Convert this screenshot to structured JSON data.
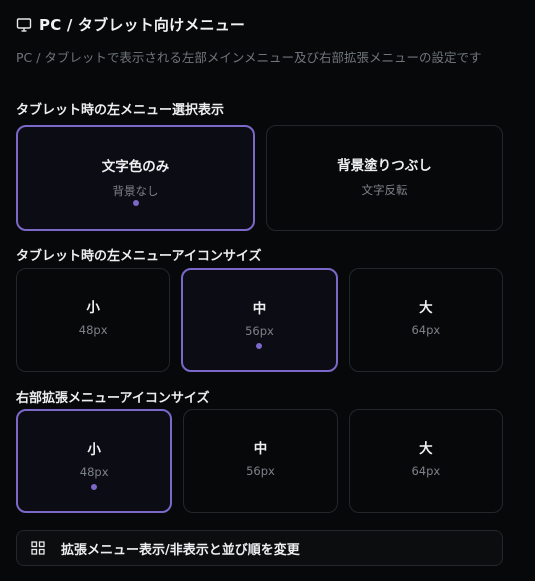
{
  "header": {
    "title": "PC / タブレット向けメニュー",
    "icon": "monitor-icon"
  },
  "description": "PC / タブレットで表示される左部メインメニュー及び右部拡張メニューの設定です",
  "tablet_left_menu_display": {
    "title": "タブレット時の左メニュー選択表示",
    "options": [
      {
        "label": "文字色のみ",
        "sub": "背景なし",
        "selected": true
      },
      {
        "label": "背景塗りつぶし",
        "sub": "文字反転",
        "selected": false
      }
    ]
  },
  "tablet_left_menu_icon_size": {
    "title": "タブレット時の左メニューアイコンサイズ",
    "options": [
      {
        "label": "小",
        "sub": "48px",
        "selected": false
      },
      {
        "label": "中",
        "sub": "56px",
        "selected": true
      },
      {
        "label": "大",
        "sub": "64px",
        "selected": false
      }
    ]
  },
  "right_menu_icon_size": {
    "title": "右部拡張メニューアイコンサイズ",
    "options": [
      {
        "label": "小",
        "sub": "48px",
        "selected": true
      },
      {
        "label": "中",
        "sub": "56px",
        "selected": false
      },
      {
        "label": "大",
        "sub": "64px",
        "selected": false
      }
    ]
  },
  "action": {
    "label": "拡張メニュー表示/非表示と並び順を変更",
    "icon": "grid-icon"
  },
  "colors": {
    "accent": "#7b68c8",
    "background": "#060809",
    "border": "#23272b",
    "muted": "#70757d"
  }
}
